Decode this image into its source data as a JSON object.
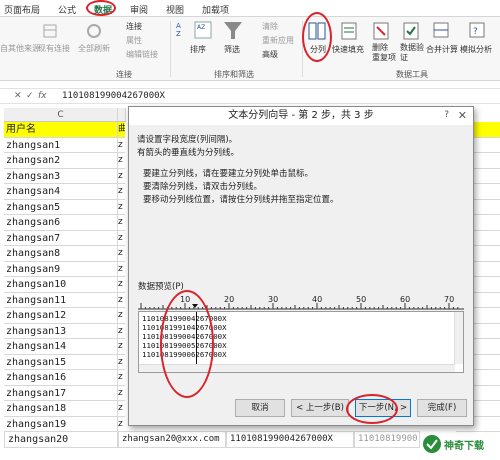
{
  "ribbon": {
    "tabs": [
      "页面布局",
      "公式",
      "数据",
      "审阅",
      "视图",
      "加载项"
    ],
    "active_tab": "数据",
    "items": {
      "from_source": "自其他来源",
      "existing_conn": "现有连接",
      "refresh_all": "全部刷新",
      "connections": "连接",
      "properties": "属性",
      "edit_links": "编辑链接",
      "sort": "排序",
      "filter": "筛选",
      "clear": "清除",
      "reapply": "重新应用",
      "advanced": "高级",
      "text_to_columns": "分列",
      "flash_fill": "快速填充",
      "remove_dup": "删除\n重复项",
      "data_validation": "数据验\n证",
      "consolidate": "合并计算",
      "what_if": "模拟分析"
    },
    "groups": {
      "connections": "连接",
      "sort_filter": "排序和筛选",
      "data_tools": "数据工具"
    }
  },
  "formula_bar": {
    "cancel": "✕",
    "confirm": "✓",
    "fx": "fx",
    "value": "110108199004267000X"
  },
  "grid": {
    "col_c": "C",
    "header_cell": "用户名",
    "header_col2": "曲",
    "rows": [
      "zhangsan1",
      "zhangsan2",
      "zhangsan3",
      "zhangsan4",
      "zhangsan5",
      "zhangsan6",
      "zhangsan7",
      "zhangsan8",
      "zhangsan9",
      "zhangsan10",
      "zhangsan11",
      "zhangsan12",
      "zhangsan13",
      "zhangsan14",
      "zhangsan15",
      "zhangsan16",
      "zhangsan17",
      "zhangsan18",
      "zhangsan19"
    ],
    "col2_char": "z",
    "last_row": {
      "user": "zhangsan20",
      "email": "zhangsan20@xxx.com",
      "id": "110108199004267000X",
      "split": "11010819900"
    }
  },
  "dialog": {
    "title": "文本分列向导 - 第 2 步，共 3 步",
    "help": "?",
    "close": "✕",
    "intro1": "请设置字段宽度(列间隔)。",
    "intro2": "有箭头的垂直线为分列线。",
    "tip1": "要建立分列线，请在要建立分列处单击鼠标。",
    "tip2": "要清除分列线，请双击分列线。",
    "tip3": "要移动分列线位置，请按住分列线并拖至指定位置。",
    "preview_label": "数据预览(P)",
    "ruler": [
      "10",
      "20",
      "30",
      "40",
      "50",
      "60",
      "70"
    ],
    "preview_lines": [
      "110108199004267000X",
      "110108199104267000X",
      "110108199004267000X",
      "110108199005267000X",
      "110108199006267000X"
    ],
    "buttons": {
      "cancel": "取消",
      "back": "< 上一步(B)",
      "next": "下一步(N) >",
      "finish": "完成(F)"
    }
  },
  "watermark": "神奇下载",
  "colors": {
    "accent": "#217346",
    "highlight": "#ffff00",
    "annotation": "#d9242b"
  }
}
